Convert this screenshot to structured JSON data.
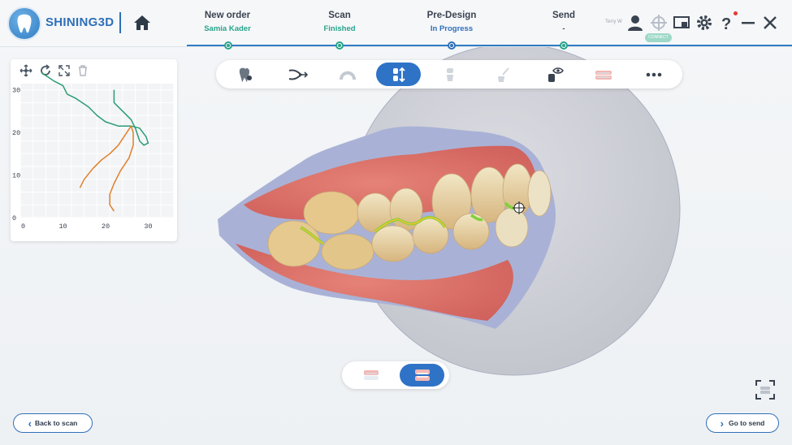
{
  "app": {
    "brand": "SHINING3D",
    "user_name": "Terry W",
    "status_pill": "CONNECT"
  },
  "steps": [
    {
      "title": "New order",
      "subtitle": "Samia Kader",
      "color": "#28a38b",
      "state": "done"
    },
    {
      "title": "Scan",
      "subtitle": "Finished",
      "color": "#28a38b",
      "state": "done"
    },
    {
      "title": "Pre-Design",
      "subtitle": "In Progress",
      "color": "#2f6fb8",
      "state": "active"
    },
    {
      "title": "Send",
      "subtitle": "-",
      "color": "#3a4350",
      "state": "pending"
    }
  ],
  "header_icons": [
    "home-icon",
    "user-icon",
    "target-icon",
    "screen-icon",
    "gear-icon",
    "help-icon",
    "minimize-icon",
    "close-icon"
  ],
  "panel_tools": [
    "move-icon",
    "refresh-icon",
    "expand-icon",
    "trash-icon"
  ],
  "chart_data": {
    "type": "line",
    "xlim": [
      0,
      30
    ],
    "ylim": [
      0,
      30
    ],
    "x_ticks": [
      "0",
      "10",
      "20",
      "30"
    ],
    "y_ticks": [
      "0",
      "10",
      "20",
      "30"
    ],
    "grid": true,
    "series": [
      {
        "color": "#2a9d73",
        "points": [
          [
            5,
            34
          ],
          [
            8,
            32
          ],
          [
            10,
            31
          ],
          [
            11,
            29
          ],
          [
            13,
            28
          ],
          [
            16,
            26
          ],
          [
            18,
            24
          ],
          [
            20,
            22.5
          ],
          [
            23,
            21.5
          ],
          [
            26,
            21.5
          ],
          [
            28,
            21
          ],
          [
            29.5,
            19
          ],
          [
            30,
            17.5
          ],
          [
            29,
            17
          ],
          [
            28,
            18
          ],
          [
            27,
            21
          ],
          [
            26,
            23
          ],
          [
            24,
            25
          ],
          [
            22,
            27
          ],
          [
            22,
            30
          ]
        ]
      },
      {
        "color": "#e0802a",
        "points": [
          [
            14,
            7
          ],
          [
            15,
            9
          ],
          [
            17,
            11.5
          ],
          [
            19,
            13.5
          ],
          [
            21,
            15
          ],
          [
            23,
            17
          ],
          [
            25,
            20
          ],
          [
            26,
            21.5
          ],
          [
            26.5,
            20
          ],
          [
            26.5,
            17
          ],
          [
            25.5,
            14
          ],
          [
            23.5,
            11
          ],
          [
            22,
            8
          ],
          [
            21,
            5.5
          ],
          [
            21,
            3
          ],
          [
            22,
            1.5
          ]
        ]
      }
    ]
  },
  "toolbar": {
    "active_index": 3,
    "items": [
      "tooth-pin-icon",
      "alignment-icon",
      "arch-icon",
      "bite-adjust-icon",
      "tooth-icon",
      "brush-icon",
      "visibility-icon",
      "jaw-view-icon",
      "more-icon"
    ]
  },
  "view_toggle": {
    "active_index": 1,
    "items": [
      "single-jaw-icon",
      "both-jaws-icon"
    ]
  },
  "nav": {
    "back_label": "Back to scan",
    "next_label": "Go to send"
  }
}
